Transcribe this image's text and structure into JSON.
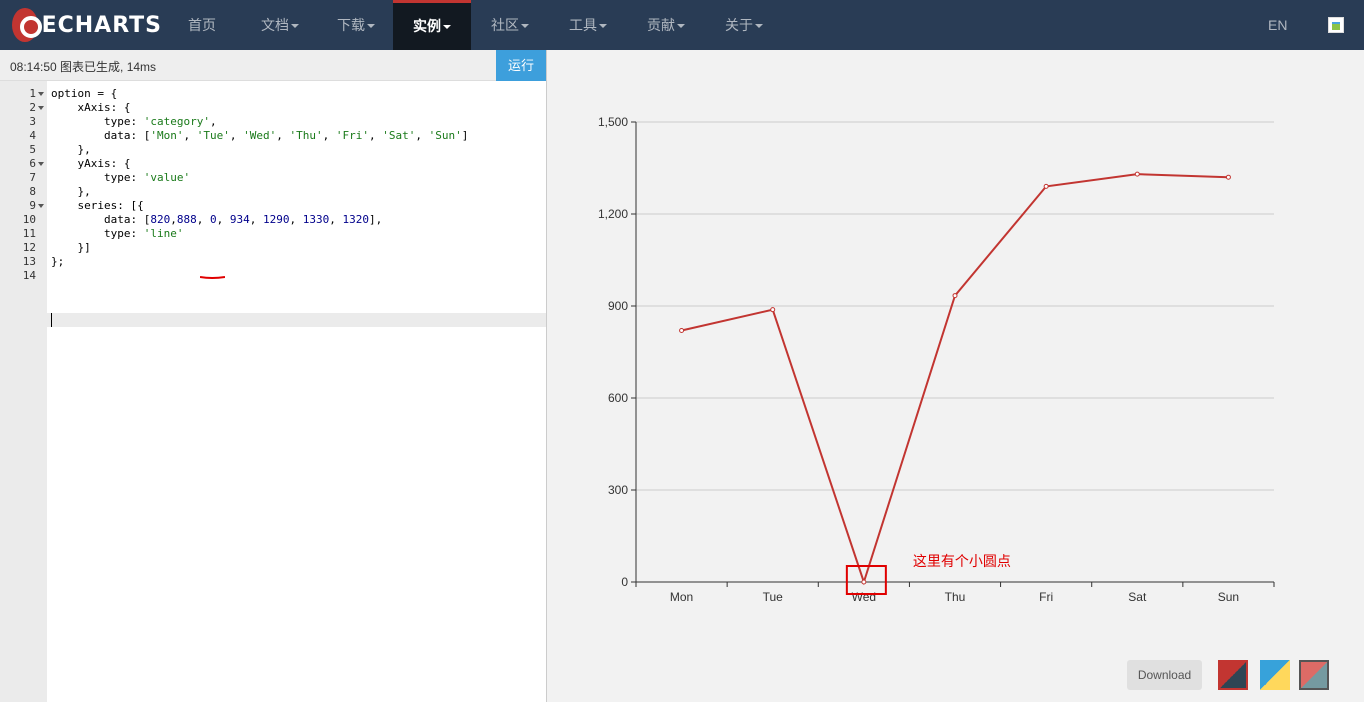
{
  "nav": {
    "logo_text": "ECHARTS",
    "items": [
      {
        "label": "首页",
        "caret": false,
        "active": false
      },
      {
        "label": "文档",
        "caret": true,
        "active": false
      },
      {
        "label": "下载",
        "caret": true,
        "active": false
      },
      {
        "label": "实例",
        "caret": true,
        "active": true
      },
      {
        "label": "社区",
        "caret": true,
        "active": false
      },
      {
        "label": "工具",
        "caret": true,
        "active": false
      },
      {
        "label": "贡献",
        "caret": true,
        "active": false
      },
      {
        "label": "关于",
        "caret": true,
        "active": false
      }
    ],
    "lang": "EN"
  },
  "editor": {
    "status": "08:14:50   图表已生成, 14ms",
    "run_label": "运行",
    "lines": [
      "option = {",
      "    xAxis: {",
      "        type: 'category',",
      "        data: ['Mon', 'Tue', 'Wed', 'Thu', 'Fri', 'Sat', 'Sun']",
      "    },",
      "    yAxis: {",
      "        type: 'value'",
      "    },",
      "    series: [{",
      "        data: [820,888, 0, 934, 1290, 1330, 1320],",
      "        type: 'line'",
      "    }]",
      "};",
      ""
    ],
    "foldable_lines": [
      1,
      2,
      6,
      9
    ]
  },
  "chart_data": {
    "type": "line",
    "categories": [
      "Mon",
      "Tue",
      "Wed",
      "Thu",
      "Fri",
      "Sat",
      "Sun"
    ],
    "values": [
      820,
      888,
      0,
      934,
      1290,
      1330,
      1320
    ],
    "ylim": [
      0,
      1500
    ],
    "yticks": [
      "0",
      "300",
      "600",
      "900",
      "1,200",
      "1,500"
    ],
    "grid": true,
    "color": "#c23531",
    "annotation": {
      "text": "这里有个小圆点",
      "target_category": "Wed",
      "color": "#e00000"
    }
  },
  "footer": {
    "download_label": "Download",
    "themes": [
      "theme-default-icon",
      "theme-light-icon",
      "theme-dark-icon"
    ]
  }
}
